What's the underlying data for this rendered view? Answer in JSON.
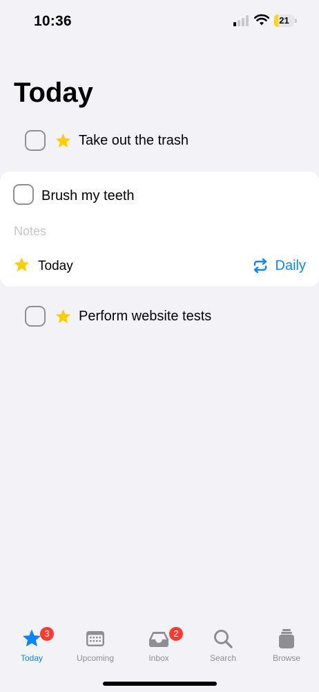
{
  "status_bar": {
    "time": "10:36",
    "battery_percent": "21",
    "battery_level": 0.21,
    "battery_color": "#ffd60a",
    "signal_bars_active": 1
  },
  "page_title": "Today",
  "tasks": [
    {
      "title": "Take out the trash",
      "starred": true,
      "icon": "star-icon"
    },
    {
      "title": "Perform website tests",
      "starred": true,
      "icon": "star-icon"
    }
  ],
  "expanded_task": {
    "title": "Brush my teeth",
    "notes_placeholder": "Notes",
    "when_label": "Today",
    "repeat_label": "Daily",
    "repeat_icon": "repeat-icon"
  },
  "tab_bar": {
    "tabs": [
      {
        "label": "Today",
        "icon": "star-icon",
        "badge": "3",
        "active": true
      },
      {
        "label": "Upcoming",
        "icon": "calendar-icon",
        "badge": "",
        "active": false
      },
      {
        "label": "Inbox",
        "icon": "inbox-tray-icon",
        "badge": "2",
        "active": false
      },
      {
        "label": "Search",
        "icon": "magnifier-icon",
        "badge": "",
        "active": false
      },
      {
        "label": "Browse",
        "icon": "stack-icon",
        "badge": "",
        "active": false
      }
    ]
  },
  "colors": {
    "accent": "#0a84ff",
    "star": "#ffcc00",
    "badge": "#ff3b30",
    "background": "#f2f2f7"
  }
}
